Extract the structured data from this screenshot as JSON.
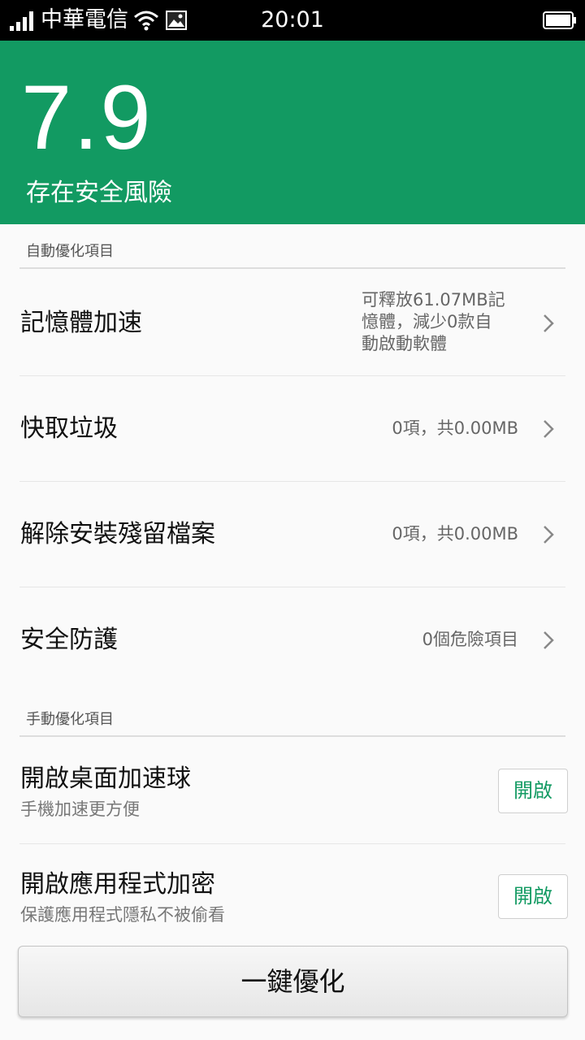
{
  "status_bar": {
    "carrier": "中華電信",
    "time": "20:01",
    "icons": [
      "signal-icon",
      "wifi-icon",
      "image-icon",
      "battery-icon"
    ]
  },
  "header": {
    "score": "7.9",
    "status": "存在安全風險",
    "background_color": "#129a62"
  },
  "auto_section": {
    "title": "自動優化項目",
    "items": [
      {
        "title": "記憶體加速",
        "detail_lines": [
          "可釋放61.07MB記",
          "憶體，減少0款自",
          "動啟動軟體"
        ]
      },
      {
        "title": "快取垃圾",
        "detail": "0項，共0.00MB"
      },
      {
        "title": "解除安裝殘留檔案",
        "detail": "0項，共0.00MB"
      },
      {
        "title": "安全防護",
        "detail": "0個危險項目"
      }
    ]
  },
  "manual_section": {
    "title": "手動優化項目",
    "items": [
      {
        "title": "開啟桌面加速球",
        "subtitle": "手機加速更方便",
        "button": "開啟"
      },
      {
        "title": "開啟應用程式加密",
        "subtitle": "保護應用程式隱私不被偷看",
        "button": "開啟"
      }
    ]
  },
  "action_button": {
    "label": "一鍵優化"
  },
  "colors": {
    "accent": "#129a62",
    "button_text": "#129a62"
  }
}
